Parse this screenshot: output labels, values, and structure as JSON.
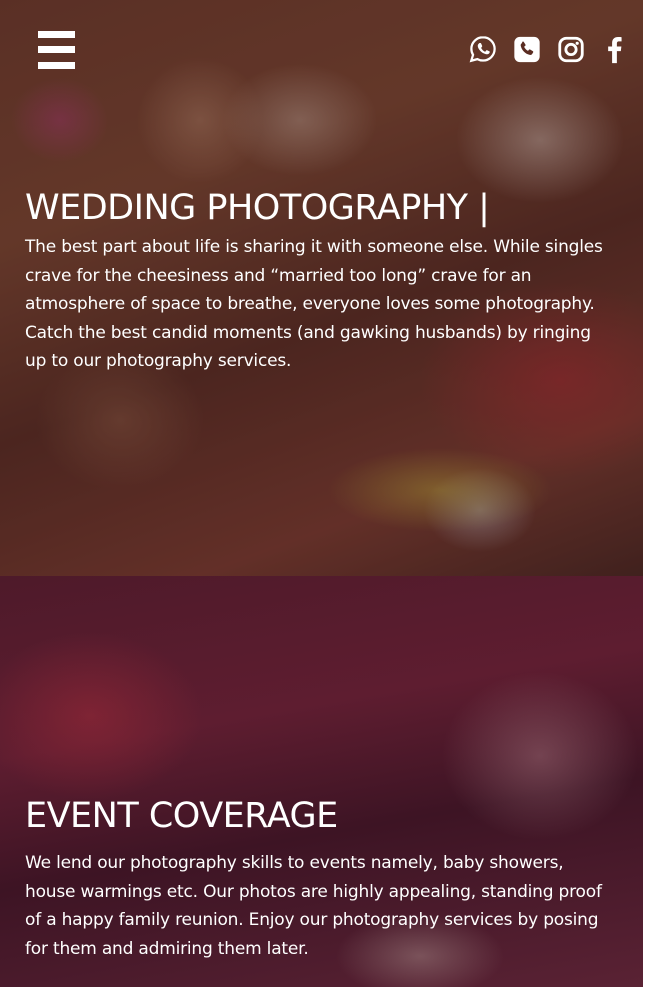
{
  "nav": {
    "menu_icon": "hamburger-menu-icon",
    "social": [
      {
        "name": "whatsapp",
        "icon": "whatsapp-icon"
      },
      {
        "name": "phone",
        "icon": "phone-icon"
      },
      {
        "name": "instagram",
        "icon": "instagram-icon"
      },
      {
        "name": "facebook",
        "icon": "facebook-icon"
      }
    ]
  },
  "sections": [
    {
      "title": "WEDDING PHOTOGRAPHY |",
      "body": "The best part about life is sharing it with someone else. While singles crave for the cheesiness and “married too long” crave for an atmosphere of space to breathe, everyone loves some photography. Catch the best candid moments (and gawking husbands) by ringing up to our photography services."
    },
    {
      "title": "EVENT COVERAGE",
      "body": "We lend our photography skills to events namely, baby showers, house warmings etc. Our photos are highly appealing, standing proof of a happy family reunion. Enjoy our photography services by posing for them and admiring them later."
    }
  ],
  "colors": {
    "text": "#ffffff",
    "page_background": "#ffffff"
  }
}
